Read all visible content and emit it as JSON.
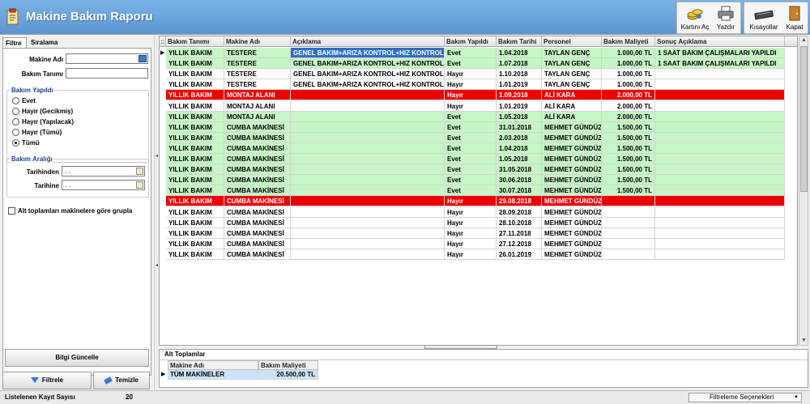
{
  "window": {
    "title": "Makine Bakım Raporu"
  },
  "toolbar": [
    {
      "label": "Kartını Aç",
      "icon": "coins-icon"
    },
    {
      "label": "Yazdır",
      "icon": "printer-icon"
    },
    {
      "label": "Kısayollar",
      "icon": "keyboard-icon"
    },
    {
      "label": "Kapat",
      "icon": "door-exit-icon"
    }
  ],
  "left": {
    "tabs": [
      "Filtre",
      "Sıralama"
    ],
    "makine_adi_label": "Makine Adı",
    "bakim_tanimi_label": "Bakım Tanımı",
    "bakim_yapildi": {
      "title": "Bakım Yapıldı",
      "options": [
        "Evet",
        "Hayır (Gecikmiş)",
        "Hayır (Yapılacak)",
        "Hayır (Tümü)",
        "Tümü"
      ],
      "selected": 4
    },
    "bakim_araligi": {
      "title": "Bakım Aralığı",
      "from_label": "Tarihinden",
      "to_label": "Tarihine",
      "from_value": ". .",
      "to_value": ". ."
    },
    "group_check": "Alt toplamları makinelere göre grupla",
    "bilgi_btn": "Bilgi Güncelle",
    "filtrele_btn": "Filtrele",
    "temizle_btn": "Temizle"
  },
  "grid": {
    "columns": [
      "Bakım Tanımı",
      "Makine Adı",
      "Açıklama",
      "Bakım Yapıldı",
      "Bakım Tarihi",
      "Personel",
      "Bakım Maliyeti",
      "Sonuç Açıklama"
    ],
    "rows": [
      {
        "c": [
          "YILLIK BAKIM",
          "TESTERE",
          "GENEL BAKIM+ARIZA KONTROL+HIZ KONTROL",
          "Evet",
          "1.04.2018",
          "TAYLAN GENÇ",
          "1.000,00 TL",
          "1 SAAT BAKIM ÇALIŞMALARI YAPILDI"
        ],
        "s": "green"
      },
      {
        "c": [
          "YILLIK BAKIM",
          "TESTERE",
          "GENEL BAKIM+ARIZA KONTROL+HIZ KONTROL",
          "Evet",
          "1.07.2018",
          "TAYLAN GENÇ",
          "1.000,00 TL",
          "1 SAAT BAKIM ÇALIŞMALARI YAPILDI"
        ],
        "s": "green"
      },
      {
        "c": [
          "YILLIK BAKIM",
          "TESTERE",
          "GENEL BAKIM+ARIZA KONTROL+HIZ KONTROL",
          "Hayır",
          "1.10.2018",
          "TAYLAN GENÇ",
          "1.000,00 TL",
          ""
        ],
        "s": "white"
      },
      {
        "c": [
          "YILLIK BAKIM",
          "TESTERE",
          "GENEL BAKIM+ARIZA KONTROL+HIZ KONTROL",
          "Hayır",
          "1.01.2019",
          "TAYLAN GENÇ",
          "1.000,00 TL",
          ""
        ],
        "s": "white"
      },
      {
        "c": [
          "YILLIK BAKIM",
          "MONTAJ ALANI",
          "",
          "Hayır",
          "1.09.2018",
          "ALİ KARA",
          "2.000,00 TL",
          ""
        ],
        "s": "red"
      },
      {
        "c": [
          "YILLIK BAKIM",
          "MONTAJ ALANI",
          "",
          "Hayır",
          "1.01.2019",
          "ALİ KARA",
          "2.000,00 TL",
          ""
        ],
        "s": "white"
      },
      {
        "c": [
          "YILLIK BAKIM",
          "MONTAJ ALANI",
          "",
          "Evet",
          "1.05.2018",
          "ALİ KARA",
          "2.000,00 TL",
          ""
        ],
        "s": "green"
      },
      {
        "c": [
          "YILLIK BAKIM",
          "CUMBA MAKİNESİ",
          "",
          "Evet",
          "31.01.2018",
          "MEHMET GÜNDÜZ",
          "1.500,00 TL",
          ""
        ],
        "s": "green"
      },
      {
        "c": [
          "YILLIK BAKIM",
          "CUMBA MAKİNESİ",
          "",
          "Evet",
          "2.03.2018",
          "MEHMET GÜNDÜZ",
          "1.500,00 TL",
          ""
        ],
        "s": "green"
      },
      {
        "c": [
          "YILLIK BAKIM",
          "CUMBA MAKİNESİ",
          "",
          "Evet",
          "1.04.2018",
          "MEHMET GÜNDÜZ",
          "1.500,00 TL",
          ""
        ],
        "s": "green"
      },
      {
        "c": [
          "YILLIK BAKIM",
          "CUMBA MAKİNESİ",
          "",
          "Evet",
          "1.05.2018",
          "MEHMET GÜNDÜZ",
          "1.500,00 TL",
          ""
        ],
        "s": "green"
      },
      {
        "c": [
          "YILLIK BAKIM",
          "CUMBA MAKİNESİ",
          "",
          "Evet",
          "31.05.2018",
          "MEHMET GÜNDÜZ",
          "1.500,00 TL",
          ""
        ],
        "s": "green"
      },
      {
        "c": [
          "YILLIK BAKIM",
          "CUMBA MAKİNESİ",
          "",
          "Evet",
          "30.06.2018",
          "MEHMET GÜNDÜZ",
          "1.500,00 TL",
          ""
        ],
        "s": "green"
      },
      {
        "c": [
          "YILLIK BAKIM",
          "CUMBA MAKİNESİ",
          "",
          "Evet",
          "30.07.2018",
          "MEHMET GÜNDÜZ",
          "1.500,00 TL",
          ""
        ],
        "s": "green"
      },
      {
        "c": [
          "YILLIK BAKIM",
          "CUMBA MAKİNESİ",
          "",
          "Hayır",
          "29.08.2018",
          "MEHMET GÜNDÜZ",
          "",
          ""
        ],
        "s": "red"
      },
      {
        "c": [
          "YILLIK BAKIM",
          "CUMBA MAKİNESİ",
          "",
          "Hayır",
          "28.09.2018",
          "MEHMET GÜNDÜZ",
          "",
          ""
        ],
        "s": "white"
      },
      {
        "c": [
          "YILLIK BAKIM",
          "CUMBA MAKİNESİ",
          "",
          "Hayır",
          "28.10.2018",
          "MEHMET GÜNDÜZ",
          "",
          ""
        ],
        "s": "white"
      },
      {
        "c": [
          "YILLIK BAKIM",
          "CUMBA MAKİNESİ",
          "",
          "Hayır",
          "27.11.2018",
          "MEHMET GÜNDÜZ",
          "",
          ""
        ],
        "s": "white"
      },
      {
        "c": [
          "YILLIK BAKIM",
          "CUMBA MAKİNESİ",
          "",
          "Hayır",
          "27.12.2018",
          "MEHMET GÜNDÜZ",
          "",
          ""
        ],
        "s": "white"
      },
      {
        "c": [
          "YILLIK BAKIM",
          "CUMBA MAKİNESİ",
          "",
          "Hayır",
          "26.01.2019",
          "MEHMET GÜNDÜZ",
          "",
          ""
        ],
        "s": "white"
      }
    ]
  },
  "subtotals": {
    "title": "Alt Toplamlar",
    "columns": [
      "Makine Adı",
      "Bakım Maliyeti"
    ],
    "rows": [
      [
        "TÜM MAKİNELER",
        "20.500,00 TL"
      ]
    ]
  },
  "status": {
    "count_label": "Listelenen Kayıt Sayısı",
    "count": "20",
    "filter_options": "Filtreleme Seçenekleri"
  },
  "colors": {
    "green": "#c6f5c6",
    "red": "#ee0000",
    "white": "#ffffff",
    "selected_cell": "#2f6fc6"
  }
}
